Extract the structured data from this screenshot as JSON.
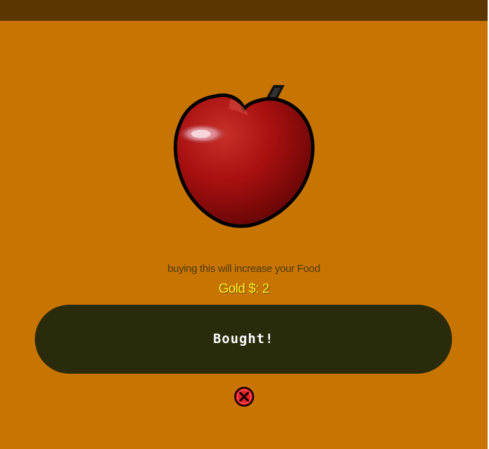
{
  "item": {
    "name_icon": "apple-icon",
    "description": "buying this will increase your Food",
    "gold_text": "Gold $: 2"
  },
  "buy_button": {
    "label": "Bought!"
  },
  "close_button": {
    "icon": "close-icon"
  },
  "colors": {
    "panel": "#c87400",
    "top_bar": "#5c3600",
    "button": "#2a2b0a",
    "gold_text": "#ffee20",
    "description_text": "#4d3a12",
    "close_icon": "#e8202a"
  }
}
